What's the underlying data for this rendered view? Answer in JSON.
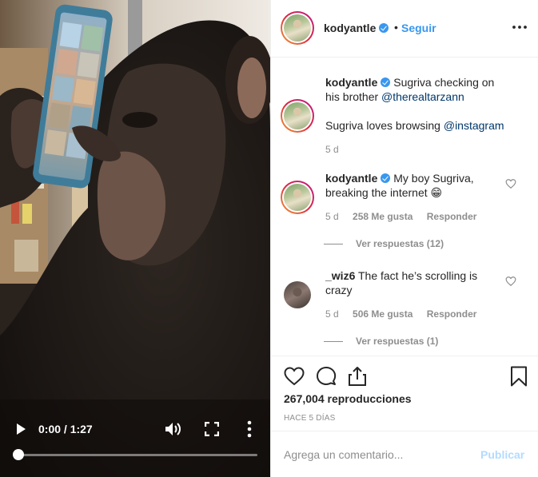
{
  "media": {
    "scene_description_icon": "chimpanzee-holding-phone-image",
    "controls": {
      "time": "0:00 / 1:27",
      "progress_fraction": 0.0,
      "play_icon": "play-icon",
      "volume_icon": "volume-icon",
      "fullscreen_icon": "fullscreen-icon",
      "more_icon": "more-vertical-icon"
    }
  },
  "header": {
    "username": "kodyantle",
    "separator": "•",
    "follow_label": "Seguir",
    "options_icon": "more-horizontal-icon"
  },
  "caption": {
    "username": "kodyantle",
    "text_1": " Sugriva checking on his brother ",
    "mention_1": "@therealtarzann",
    "text_2": "Sugriva loves browsing ",
    "mention_2": "@instagram",
    "age": "5 d"
  },
  "comments": [
    {
      "username": "kodyantle",
      "text": " My boy Sugriva, breaking the internet 😁",
      "age": "5 d",
      "likes": "258 Me gusta",
      "reply_label": "Responder",
      "view_replies": "Ver respuestas (12)"
    },
    {
      "username": "_wiz6",
      "text": " The fact he’s scrolling is crazy",
      "age": "5 d",
      "likes": "506 Me gusta",
      "reply_label": "Responder",
      "view_replies": "Ver respuestas (1)"
    }
  ],
  "actions": {
    "views": "267,004 reproducciones",
    "posted_ago": "HACE 5 DÍAS"
  },
  "comment_box": {
    "placeholder": "Agrega un comentario...",
    "publish_label": "Publicar"
  },
  "colors": {
    "link_blue": "#3897f0",
    "mention_blue": "#00376b",
    "muted_gray": "#8e8e8e",
    "publish_disabled": "#b3dbff"
  }
}
